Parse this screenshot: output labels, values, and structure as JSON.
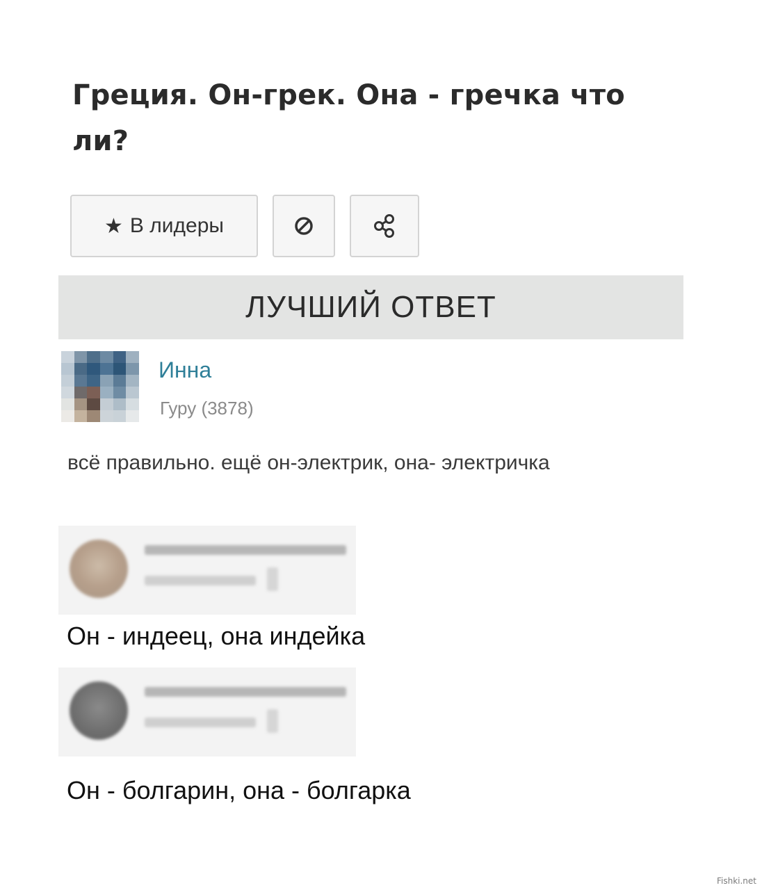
{
  "question": {
    "title": "Греция. Он-грек. Она - гречка что ли?"
  },
  "actions": {
    "leaders_label": "В лидеры",
    "star_icon": "star-icon",
    "block_icon": "block-icon",
    "share_icon": "share-icon"
  },
  "best_answer": {
    "header": "ЛУЧШИЙ ОТВЕТ",
    "user_name": "Инна",
    "user_rank": "Гуру (3878)",
    "text": "всё правильно. ещё он-электрик, она- электричка"
  },
  "answers": [
    {
      "text": "Он - индеец, она индейка"
    },
    {
      "text": "Он - болгарин, она - болгарка"
    }
  ],
  "watermark": "Fishki.net",
  "colors": {
    "user_name": "#2f7f98",
    "best_answer_bar": "#e3e4e3",
    "button_border": "#d3d3d3"
  }
}
